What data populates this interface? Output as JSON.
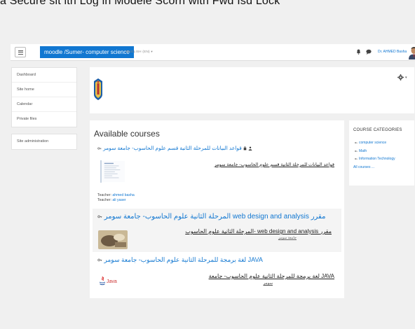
{
  "caption": "a Secure sit ith Log in Modele Scorn with Fwd Isd Lock",
  "navbar": {
    "site_name": "moodle /Sumer- computer science",
    "language": "ENGLISH (EN) ▾",
    "user_name": "Dr. AHMED Basha",
    "user_caret": "▾"
  },
  "sidebar": {
    "nav_items": [
      "Dashboard",
      "Site home",
      "Calendar",
      "Private files"
    ],
    "admin_items": [
      "Site administration"
    ]
  },
  "header": {
    "gear_caret": "▾"
  },
  "main": {
    "title": "Available courses",
    "courses": [
      {
        "title": "قواعد البيانات للمرحلة الثانية قسم علوم الحاسوب- جامعة سومر",
        "description": "قواعد البيانات للمرحلة الثانية قسم علوم الحاسوب- جامعة سومر",
        "teachers": [
          {
            "label": "Teacher: ",
            "name": "ahmed basha"
          },
          {
            "label": "Teacher: ",
            "name": "ali yaser"
          }
        ]
      },
      {
        "title": "المرحلة الثانية علوم الحاسوب- جامعة سومر web design and analysis مقرر",
        "description": "المرحلة الثانية علوم الحاسوب- web design and analysis مقرر",
        "description2": "جامعة سومر"
      },
      {
        "title": "لغة برمجة للمرحلة الثانية علوم الحاسوب- جامعة سومر JAVA",
        "description": "لغة برمجة للمرحلة الثانية علوم الحاسوب- جامعة JAVA",
        "description2": "سومر",
        "thumb_label": "Java"
      }
    ]
  },
  "categories": {
    "heading": "COURSE CATEGORIES",
    "items": [
      "computer science",
      "Math",
      "Information Technology"
    ],
    "all_link": "All courses ..."
  },
  "colors": {
    "accent": "#1177d1",
    "background": "#f0f0f0"
  }
}
